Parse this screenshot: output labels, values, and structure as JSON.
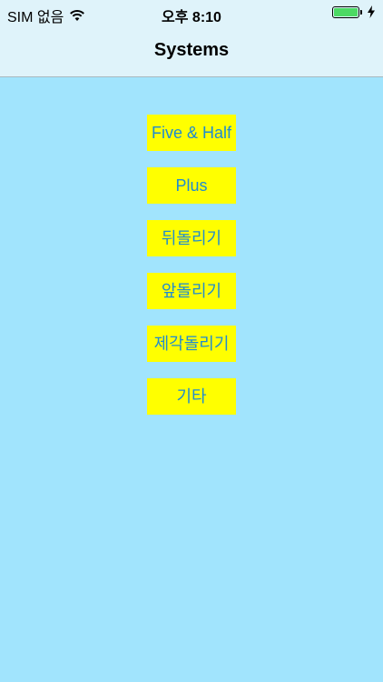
{
  "status_bar": {
    "carrier": "SIM 없음",
    "time": "오후 8:10",
    "battery_level": 1.0,
    "charging": true
  },
  "nav": {
    "title": "Systems"
  },
  "menu": {
    "items": [
      {
        "label": "Five & Half"
      },
      {
        "label": "Plus"
      },
      {
        "label": "뒤돌리기"
      },
      {
        "label": "앞돌리기"
      },
      {
        "label": "제각돌리기"
      },
      {
        "label": "기타"
      }
    ]
  },
  "colors": {
    "background": "#a1e4fd",
    "bar_background": "#dff3fa",
    "button_background": "#ffff00",
    "button_text": "#1f8bd1",
    "battery_fill": "#4cd964"
  }
}
